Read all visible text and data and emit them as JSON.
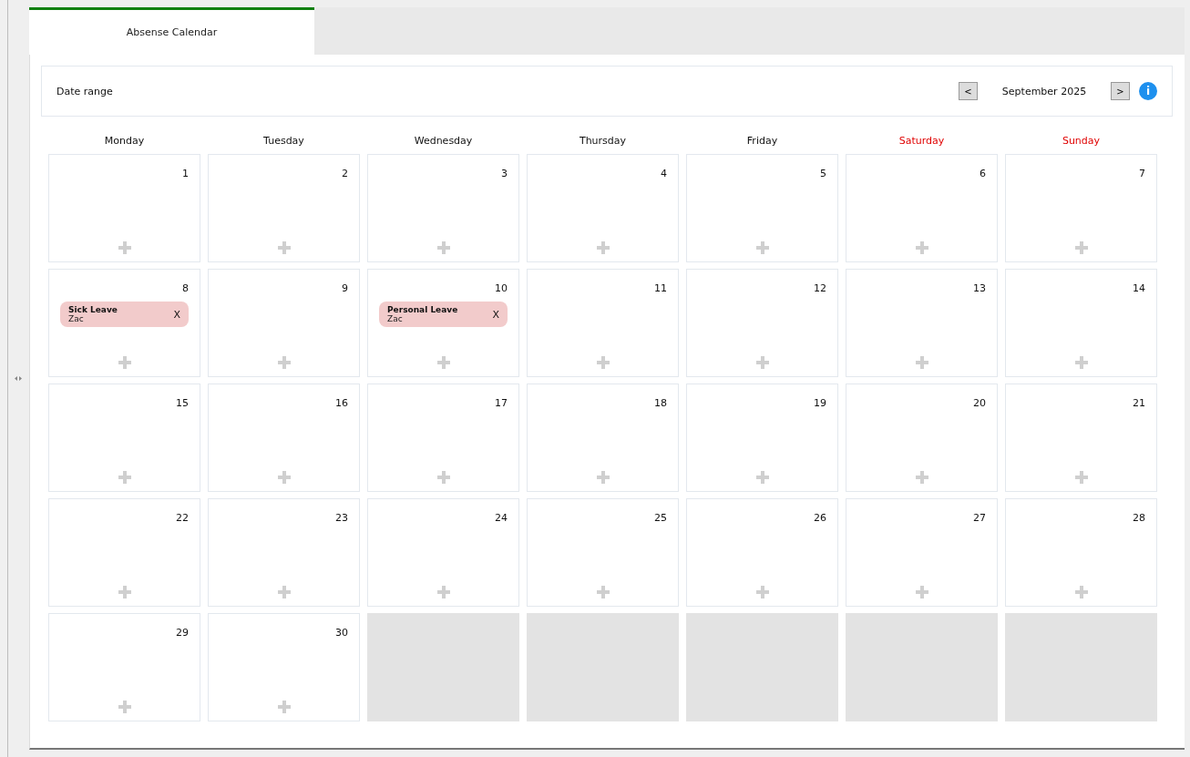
{
  "tabs": [
    {
      "label": "Absense Calendar",
      "selected": true
    }
  ],
  "header": {
    "label": "Date range",
    "prev": "<",
    "month": "September 2025",
    "next": ">",
    "info": "i"
  },
  "weekdays": [
    {
      "name": "Monday",
      "weekend": false
    },
    {
      "name": "Tuesday",
      "weekend": false
    },
    {
      "name": "Wednesday",
      "weekend": false
    },
    {
      "name": "Thursday",
      "weekend": false
    },
    {
      "name": "Friday",
      "weekend": false
    },
    {
      "name": "Saturday",
      "weekend": true
    },
    {
      "name": "Sunday",
      "weekend": true
    }
  ],
  "cells": [
    {
      "kind": "day",
      "day": "1"
    },
    {
      "kind": "day",
      "day": "2"
    },
    {
      "kind": "day",
      "day": "3"
    },
    {
      "kind": "day",
      "day": "4"
    },
    {
      "kind": "day",
      "day": "5"
    },
    {
      "kind": "day",
      "day": "6"
    },
    {
      "kind": "day",
      "day": "7"
    },
    {
      "kind": "day",
      "day": "8",
      "events": [
        {
          "title": "Sick Leave",
          "person": "Zac",
          "remove": "X"
        }
      ]
    },
    {
      "kind": "day",
      "day": "9"
    },
    {
      "kind": "day",
      "day": "10",
      "events": [
        {
          "title": "Personal Leave",
          "person": "Zac",
          "remove": "X"
        }
      ]
    },
    {
      "kind": "day",
      "day": "11"
    },
    {
      "kind": "day",
      "day": "12"
    },
    {
      "kind": "day",
      "day": "13"
    },
    {
      "kind": "day",
      "day": "14"
    },
    {
      "kind": "day",
      "day": "15"
    },
    {
      "kind": "day",
      "day": "16"
    },
    {
      "kind": "day",
      "day": "17"
    },
    {
      "kind": "day",
      "day": "18"
    },
    {
      "kind": "day",
      "day": "19"
    },
    {
      "kind": "day",
      "day": "20"
    },
    {
      "kind": "day",
      "day": "21"
    },
    {
      "kind": "day",
      "day": "22"
    },
    {
      "kind": "day",
      "day": "23"
    },
    {
      "kind": "day",
      "day": "24"
    },
    {
      "kind": "day",
      "day": "25"
    },
    {
      "kind": "day",
      "day": "26"
    },
    {
      "kind": "day",
      "day": "27"
    },
    {
      "kind": "day",
      "day": "28"
    },
    {
      "kind": "day",
      "day": "29"
    },
    {
      "kind": "day",
      "day": "30"
    },
    {
      "kind": "blank"
    },
    {
      "kind": "blank"
    },
    {
      "kind": "blank"
    },
    {
      "kind": "blank"
    },
    {
      "kind": "blank"
    }
  ]
}
